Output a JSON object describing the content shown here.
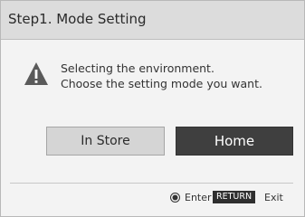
{
  "dialog": {
    "title": "Step1. Mode Setting",
    "message_line1": "Selecting the environment.",
    "message_line2": "Choose the setting mode you want.",
    "warning_icon": "warning-triangle-icon"
  },
  "buttons": {
    "in_store": "In Store",
    "home": "Home",
    "selected": "Home"
  },
  "footer": {
    "enter_icon": "ok-button-icon",
    "enter_label": "Enter",
    "return_key": "RETURN",
    "exit_label": "Exit"
  },
  "colors": {
    "header_bg": "#dcdcdc",
    "selected_button_bg": "#3f3f3f",
    "unselected_button_bg": "#d5d5d5"
  }
}
